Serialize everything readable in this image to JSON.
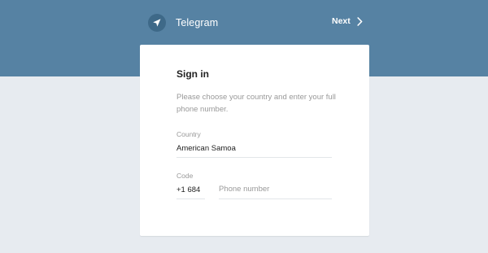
{
  "header": {
    "brand_name": "Telegram",
    "next_label": "Next",
    "background_color": "#5682a3",
    "logo_icon": "paper-plane-icon",
    "next_icon": "chevron-right-icon"
  },
  "signin": {
    "title": "Sign in",
    "description": "Please choose your country and enter your full phone number.",
    "country": {
      "label": "Country",
      "value": "American Samoa"
    },
    "code": {
      "label": "Code",
      "value": "+1 684"
    },
    "phone": {
      "placeholder": "Phone number",
      "value": ""
    }
  },
  "colors": {
    "page_background": "#e7ebf0",
    "card_background": "#ffffff",
    "muted_text": "#999999"
  }
}
